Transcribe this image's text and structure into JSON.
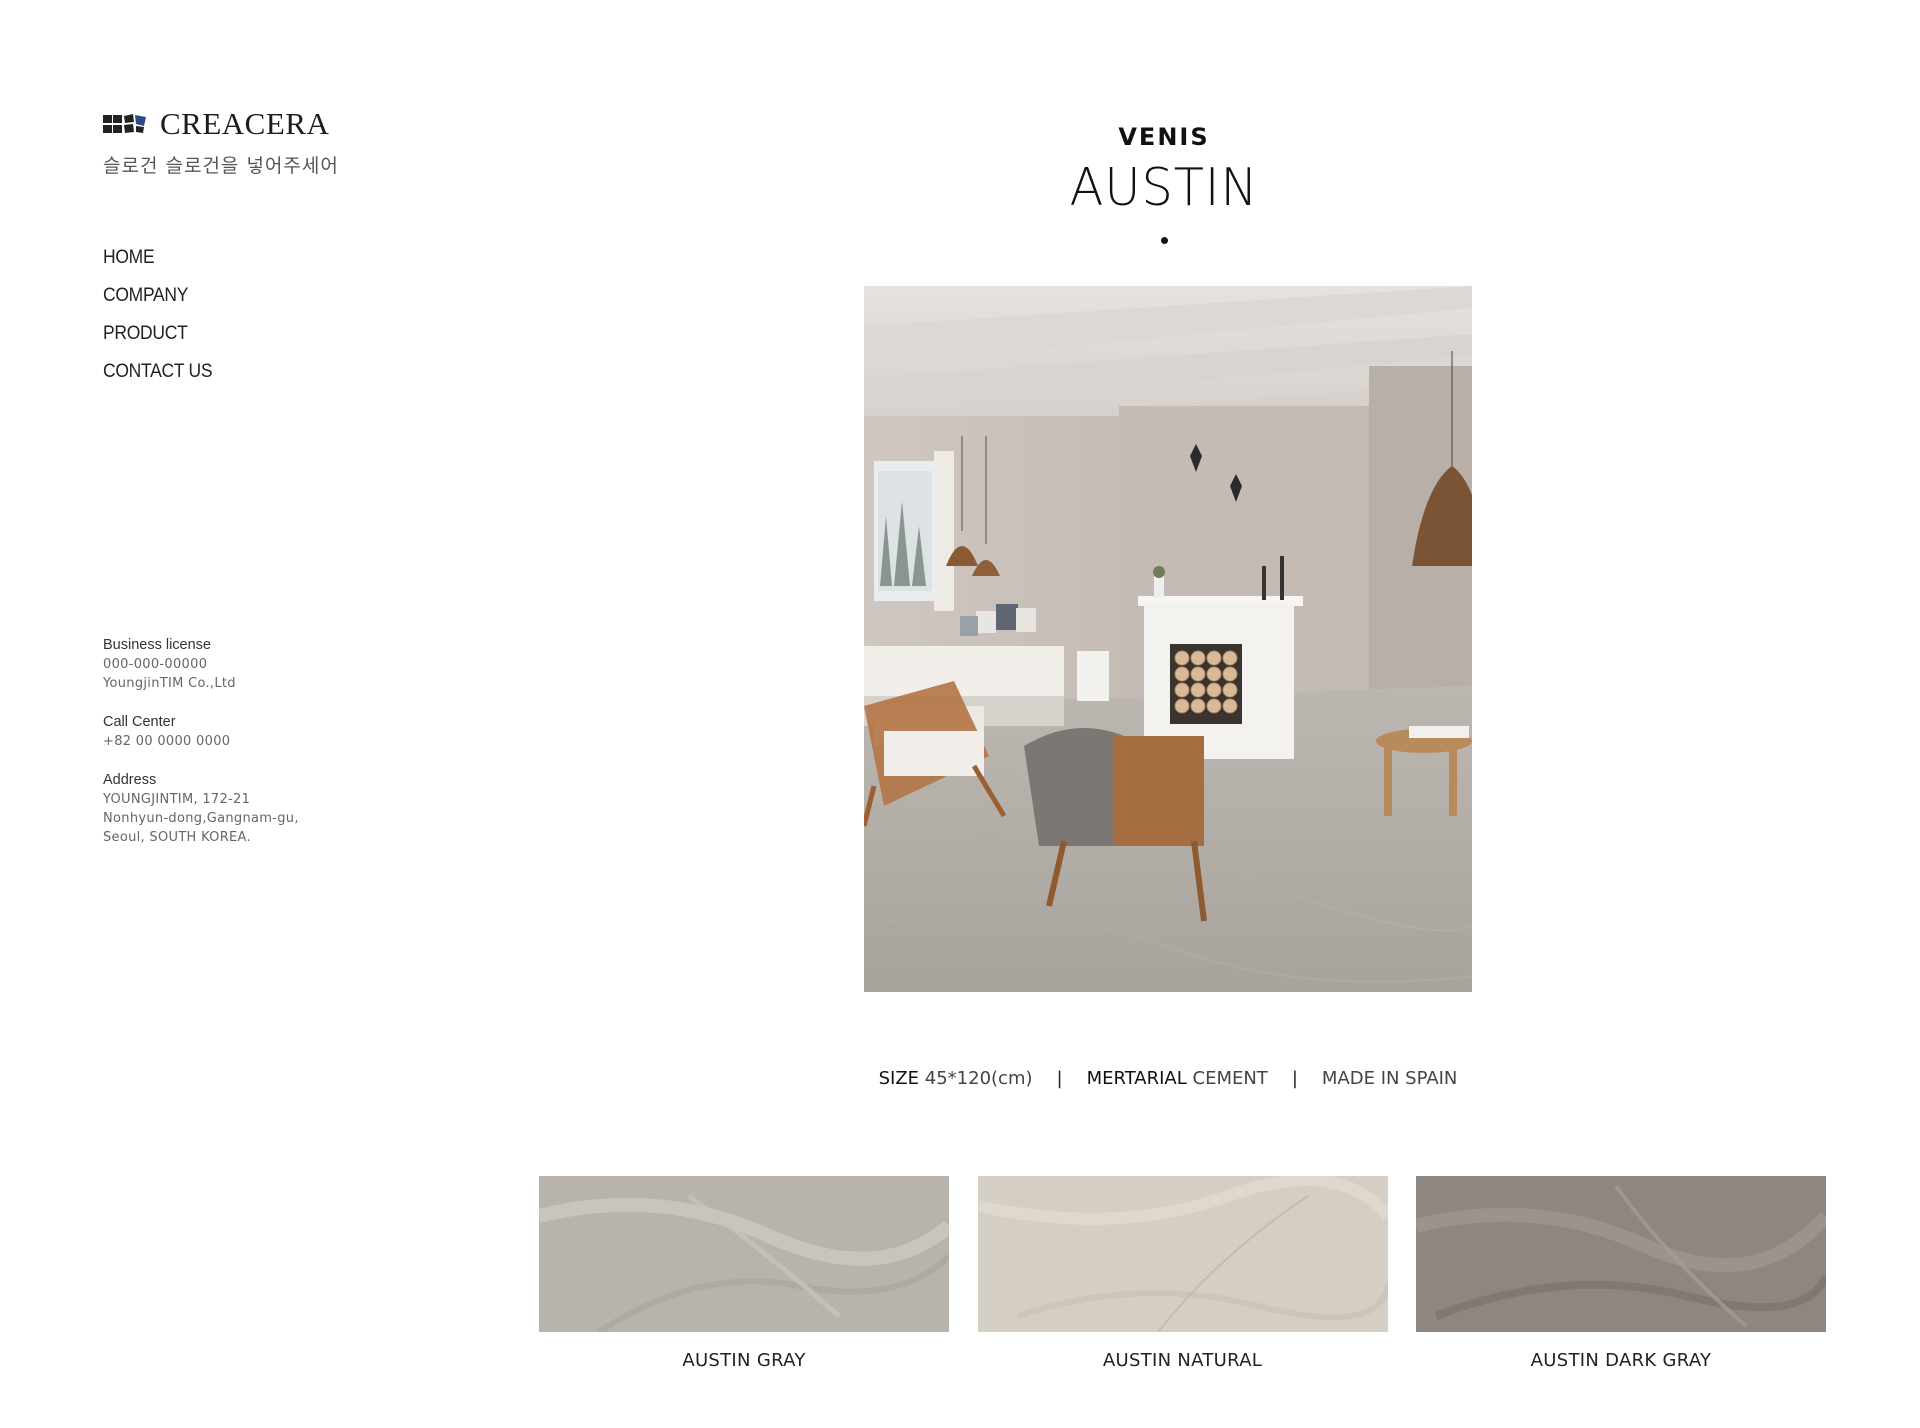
{
  "brand": {
    "logo_text": "CREACERA",
    "slogan": "슬로건 슬로건을 넣어주세어"
  },
  "nav": {
    "items": [
      "HOME",
      "COMPANY",
      "PRODUCT",
      "CONTACT US"
    ]
  },
  "info": {
    "business_license_label": "Business license",
    "business_license_number": "000-000-00000",
    "company_name": "YoungjinTIM Co.,Ltd",
    "call_center_label": "Call Center",
    "call_center_number": "+82 00 0000 0000",
    "address_label": "Address",
    "address_lines": [
      "YOUNGJINTIM, 172-21",
      "Nonhyun-dong,Gangnam-gu,",
      "Seoul, SOUTH KOREA."
    ]
  },
  "product": {
    "collection": "VENIS",
    "name": "AUSTIN"
  },
  "specs": {
    "size_label": "SIZE",
    "size_value": "45*120(cm)",
    "separator": "|",
    "material_label": "MERTARIAL",
    "material_value": "CEMENT",
    "origin": "MADE IN SPAIN"
  },
  "swatches": [
    {
      "name": "AUSTIN GRAY",
      "color": "#b9b3ad"
    },
    {
      "name": "AUSTIN NATURAL",
      "color": "#d4cec4"
    },
    {
      "name": "AUSTIN DARK GRAY",
      "color": "#8e8781"
    }
  ]
}
